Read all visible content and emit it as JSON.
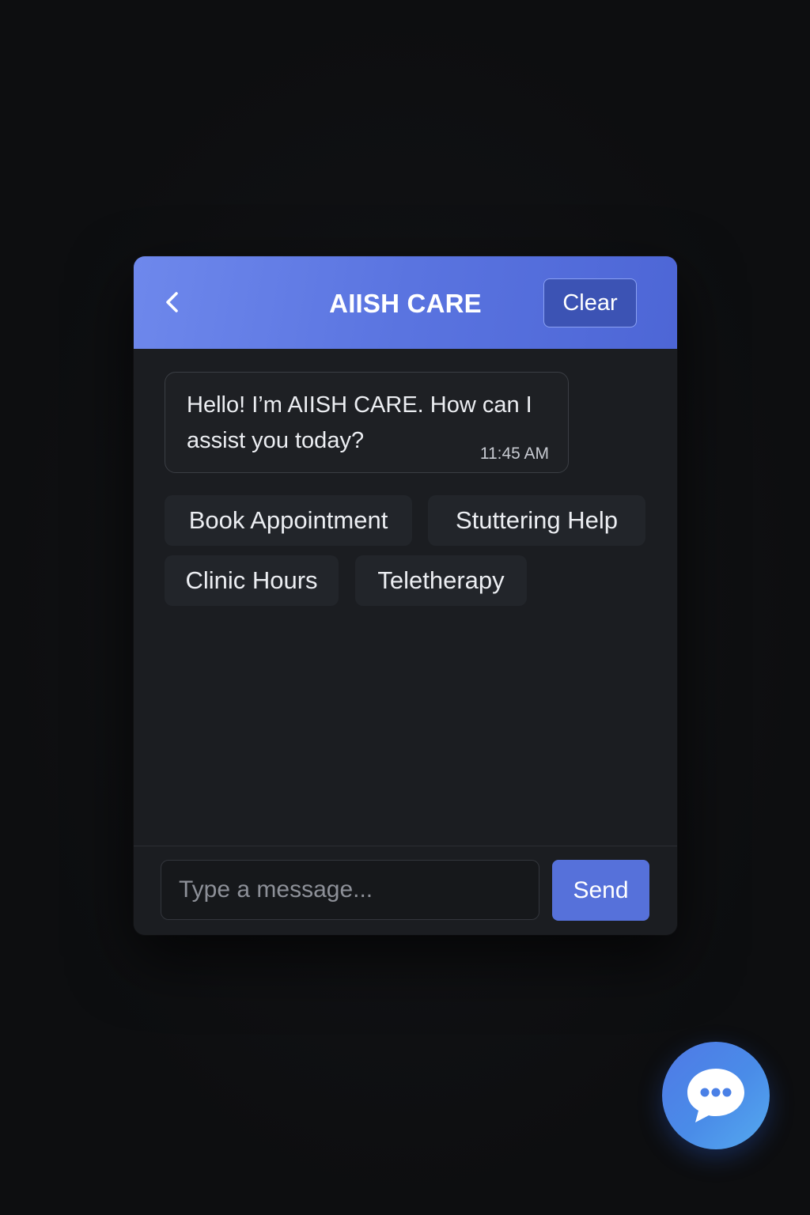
{
  "header": {
    "title": "AIISH CARE",
    "back_icon": "chevron-left-icon",
    "clear_label": "Clear",
    "gradient_colors": [
      "#6e88ec",
      "#4d66d6"
    ]
  },
  "messages": [
    {
      "sender": "bot",
      "text": "Hello! I’m AIISH CARE. How can I assist you today?",
      "time": "11:45 AM"
    }
  ],
  "quick_replies": [
    {
      "label": "Book Appointment"
    },
    {
      "label": "Stuttering Help"
    },
    {
      "label": "Clinic Hours"
    },
    {
      "label": "Teletherapy"
    }
  ],
  "composer": {
    "placeholder": "Type a message...",
    "value": "",
    "send_label": "Send"
  },
  "launcher": {
    "icon": "chat-bubble-icon",
    "gradient_colors": [
      "#4f79e6",
      "#55aaf0"
    ]
  },
  "colors": {
    "accent": "#5671da",
    "background": "#0d0e10",
    "panel": "#1b1d21",
    "text": "#eceef2"
  }
}
